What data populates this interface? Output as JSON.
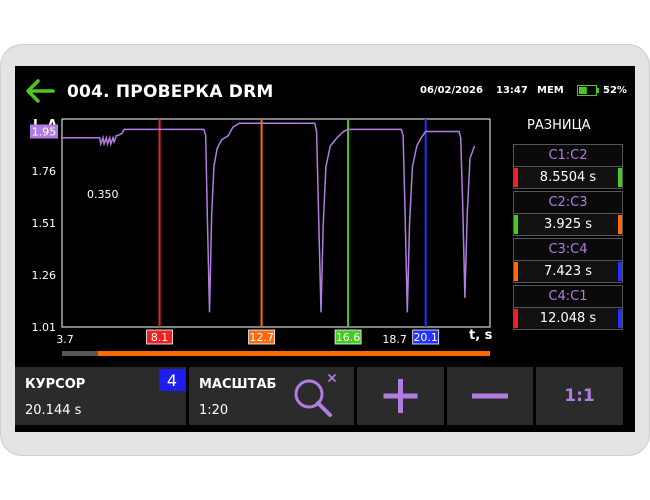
{
  "header": {
    "title": "004. ПРОВЕРКА DRM",
    "date": "06/02/2026",
    "time": "13:47",
    "mem_label": "MEM",
    "battery_level": 0.52,
    "battery_text": "52%",
    "back_icon": "arrow-left-icon",
    "accent": "#4ec81e"
  },
  "chart_data": {
    "type": "line",
    "xlabel": "t, s",
    "ylabel": "I, A",
    "ylim": [
      1.01,
      2.01
    ],
    "xlim": [
      3.7,
      23.0
    ],
    "ytick_labels": [
      "1.95",
      "1.76",
      "1.51",
      "1.26",
      "1.01"
    ],
    "ytick_values": [
      1.95,
      1.76,
      1.51,
      1.26,
      1.01
    ],
    "xtick_labels": [
      "3.7",
      "18.7"
    ],
    "xtick_values": [
      3.7,
      18.7
    ],
    "annotation": "0.350",
    "series_color": "#b27de0",
    "series": [
      {
        "x": [
          3.7,
          5.4,
          5.45,
          5.55,
          5.6,
          5.7,
          5.75,
          5.85,
          5.9,
          6.0,
          6.05,
          6.15,
          6.2,
          6.4,
          6.5,
          10.1,
          10.18,
          10.25,
          10.35,
          10.45,
          10.55,
          10.7,
          10.9,
          11.2,
          11.4,
          11.7,
          11.8,
          15.1,
          15.18,
          15.27,
          15.38,
          15.48,
          15.6,
          15.8,
          16.1,
          16.4,
          16.6,
          19.0,
          19.08,
          19.17,
          19.27,
          19.37,
          19.5,
          19.7,
          19.9,
          20.1,
          21.6,
          21.68,
          21.77,
          21.87,
          21.97,
          22.1,
          22.3
        ],
        "y": [
          1.92,
          1.92,
          1.89,
          1.92,
          1.89,
          1.92,
          1.89,
          1.92,
          1.89,
          1.92,
          1.9,
          1.93,
          1.93,
          1.94,
          1.96,
          1.96,
          1.93,
          1.55,
          1.08,
          1.55,
          1.78,
          1.87,
          1.91,
          1.93,
          1.97,
          1.99,
          1.99,
          1.99,
          1.95,
          1.55,
          1.08,
          1.5,
          1.78,
          1.88,
          1.92,
          1.95,
          1.96,
          1.96,
          1.93,
          1.55,
          1.08,
          1.5,
          1.78,
          1.88,
          1.92,
          1.95,
          1.95,
          1.92,
          1.6,
          1.15,
          1.55,
          1.82,
          1.88
        ]
      }
    ],
    "y_readout": {
      "value": "1.95",
      "color": "#b27de0"
    },
    "cursors": [
      {
        "label": "8.1",
        "x": 8.1,
        "color": "#ee2222"
      },
      {
        "label": "12.7",
        "x": 12.7,
        "color": "#ff6a10"
      },
      {
        "label": "16.6",
        "x": 16.6,
        "color": "#44cc22"
      },
      {
        "label": "20.1",
        "x": 20.1,
        "color": "#2233ff"
      }
    ]
  },
  "diff": {
    "title": "РАЗНИЦА",
    "items": [
      {
        "head": "C1:C2",
        "value": "8.5504 s",
        "left": "#ee2222",
        "right": "#44cc22"
      },
      {
        "head": "C2:C3",
        "value": "3.925 s",
        "left": "#44cc22",
        "right": "#ff6a10"
      },
      {
        "head": "C3:C4",
        "value": "7.423 s",
        "left": "#ff6a10",
        "right": "#2233ff"
      },
      {
        "head": "C4:C1",
        "value": "12.048 s",
        "left": "#ee2222",
        "right": "#2233ff"
      }
    ]
  },
  "scroll": {
    "start": 0.085,
    "end": 1.0,
    "color": "#ff6a00"
  },
  "bottom": {
    "cursor_label": "КУРСОР",
    "cursor_value": "20.144 s",
    "cursor_badge": "4",
    "scale_label": "МАСШТАБ",
    "scale_value": "1:20",
    "zoom_icon": "zoom-reset-icon",
    "plus_icon": "plus-icon",
    "minus_icon": "minus-icon",
    "one_to_one": "1:1",
    "accent": "#b27de0"
  }
}
